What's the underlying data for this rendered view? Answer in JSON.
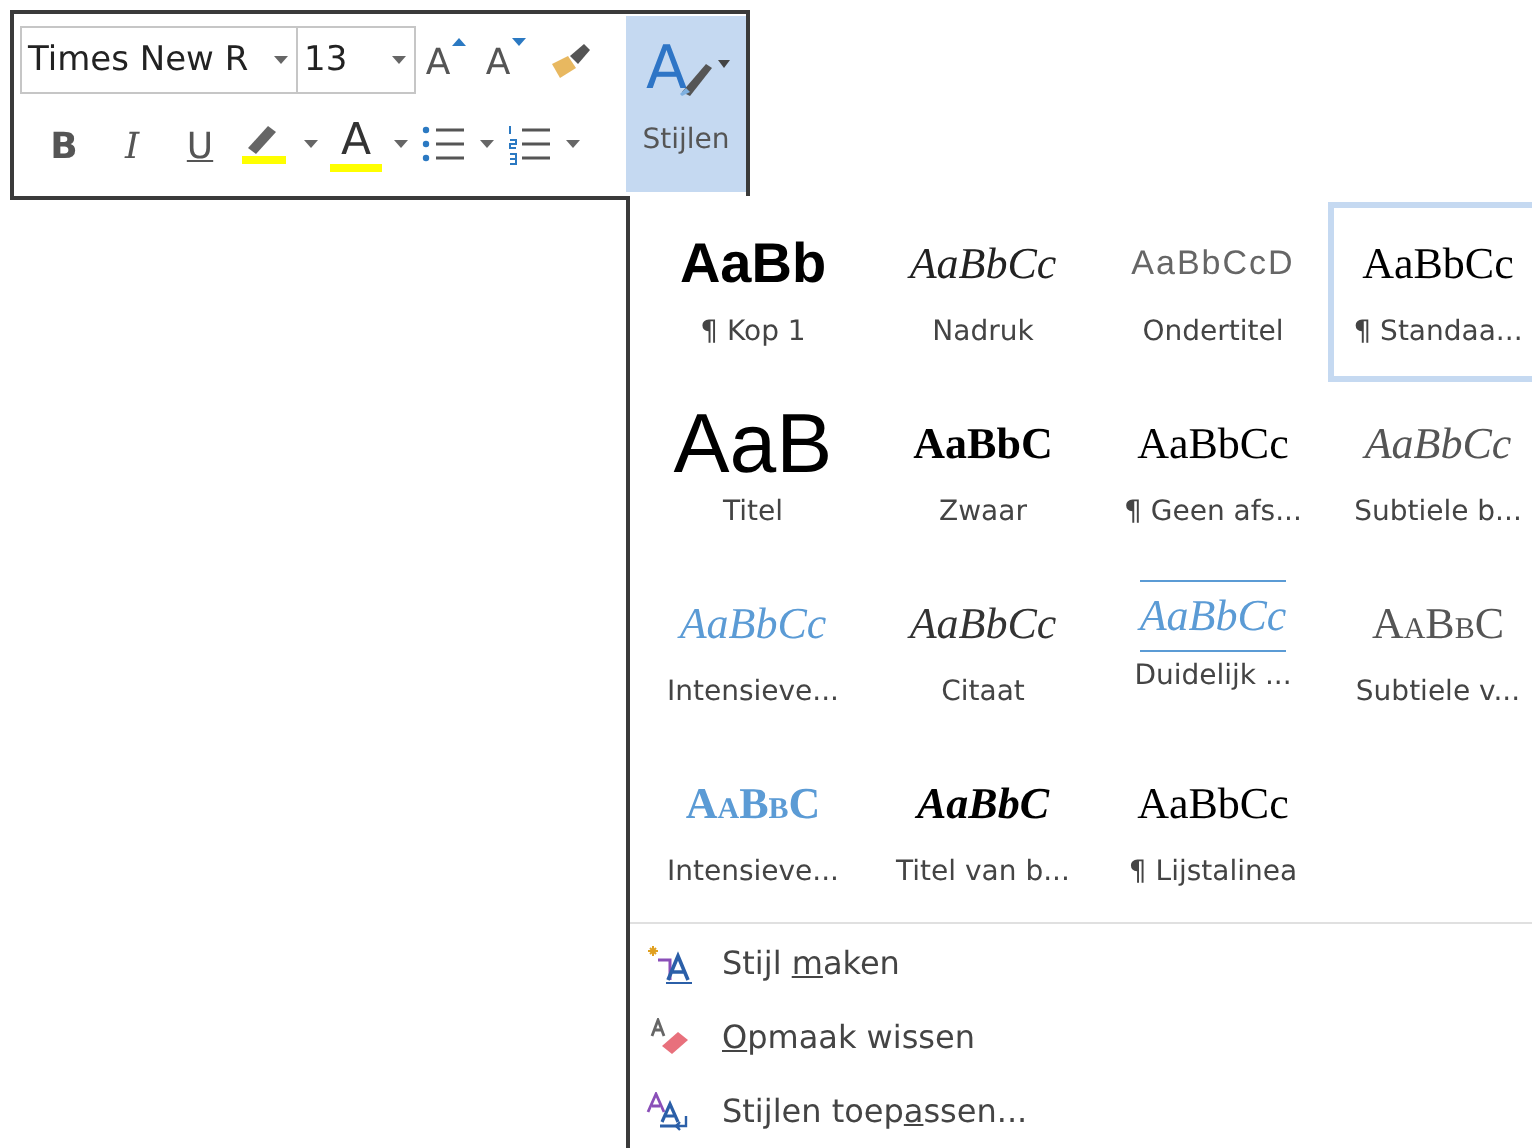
{
  "toolbar": {
    "font_name": "Times New R",
    "font_size": "13",
    "grow_font": {
      "glyph": "A"
    },
    "shrink_font": {
      "glyph": "A"
    },
    "format_buttons": [
      {
        "kind": "bold",
        "glyph": "B"
      },
      {
        "kind": "italic",
        "glyph": "I"
      },
      {
        "kind": "underline",
        "glyph": "U"
      }
    ],
    "font_color": {
      "glyph": "A"
    },
    "styles_button": {
      "glyph": "A",
      "label": "Stijlen",
      "selected": true
    }
  },
  "gallery": [
    {
      "kind": "heading1",
      "preview": "AaBb",
      "label": "¶ Kop 1",
      "selected": false
    },
    {
      "kind": "emphasis",
      "preview": "AaBbCc",
      "label": "Nadruk",
      "selected": false
    },
    {
      "kind": "subtitle",
      "preview": "AaBbCcD",
      "label": "Ondertitel",
      "selected": false
    },
    {
      "kind": "normal",
      "preview": "AaBbCc",
      "label": "¶ Standaa...",
      "selected": true
    },
    {
      "kind": "title",
      "preview": "AaB",
      "label": "Titel",
      "selected": false
    },
    {
      "kind": "strong",
      "preview": "AaBbC",
      "label": "Zwaar",
      "selected": false
    },
    {
      "kind": "plain",
      "preview": "AaBbCc",
      "label": "¶ Geen afs...",
      "selected": false
    },
    {
      "kind": "subtle-emphasis",
      "preview": "AaBbCc",
      "label": "Subtiele b...",
      "selected": false
    },
    {
      "kind": "intense-emphasis",
      "preview": "AaBbCc",
      "label": "Intensieve...",
      "selected": false
    },
    {
      "kind": "quote",
      "preview": "AaBbCc",
      "label": "Citaat",
      "selected": false
    },
    {
      "kind": "intense-quote",
      "preview": "AaBbCc",
      "label": "Duidelijk ...",
      "selected": false
    },
    {
      "kind": "subtle-reference",
      "preview": "AaBbC",
      "label": "Subtiele v...",
      "selected": false
    },
    {
      "kind": "intense-reference",
      "preview": "AaBbC",
      "label": "Intensieve...",
      "selected": false
    },
    {
      "kind": "book-title",
      "preview": "AaBbC",
      "label": "Titel van b...",
      "selected": false
    },
    {
      "kind": "plain",
      "preview": "AaBbCc",
      "label": "¶ Lijstalinea",
      "selected": false
    }
  ],
  "menu": [
    {
      "kind": "create",
      "before": "Stijl ",
      "key": "m",
      "after": "aken"
    },
    {
      "kind": "clear",
      "key": "O",
      "after": "pmaak wissen"
    },
    {
      "kind": "apply",
      "before": "Stijlen toep",
      "key": "a",
      "after": "ssen..."
    }
  ]
}
